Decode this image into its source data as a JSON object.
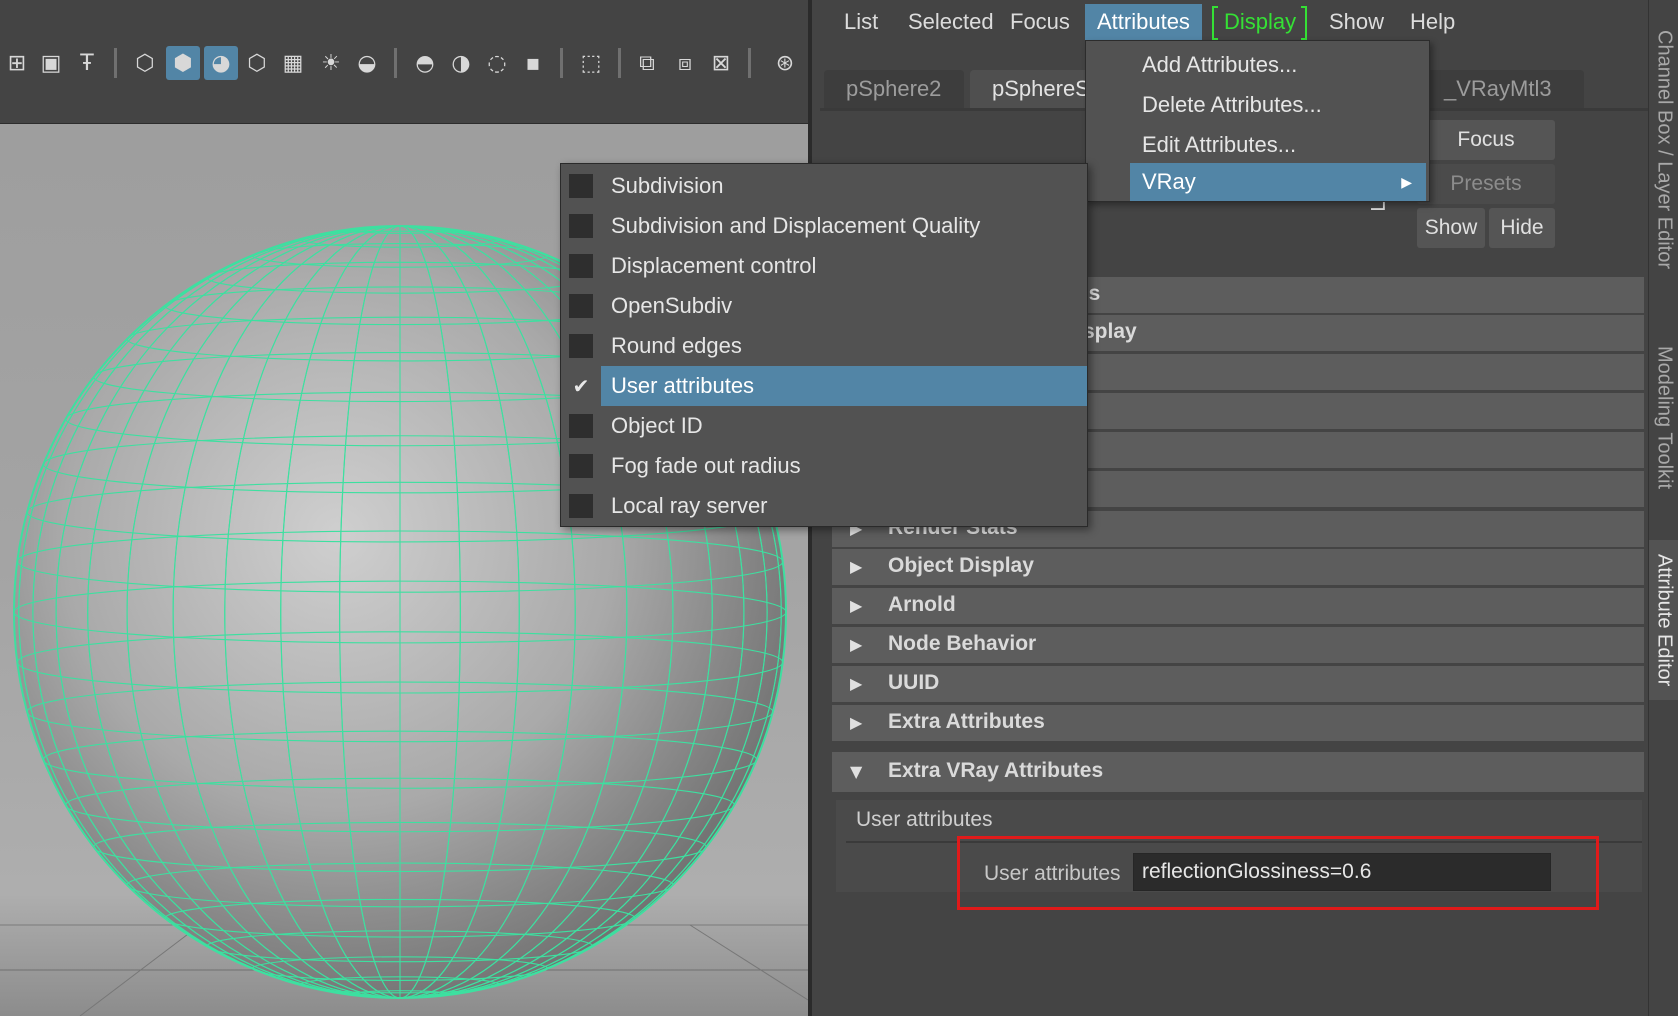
{
  "menubar": {
    "list": "List",
    "selected": "Selected",
    "focus": "Focus",
    "attributes": "Attributes",
    "display": "Display",
    "show": "Show",
    "help": "Help"
  },
  "tabs": {
    "psphere2": "pSphere2",
    "psphere_shape": "pSphereS",
    "vraymtl": "_VRayMtl3"
  },
  "buttons": {
    "focus": "Focus",
    "presets": "Presets",
    "show": "Show",
    "hide": "Hide"
  },
  "sections": {
    "partial1": "tes",
    "partial2": "Display",
    "render_stats": "Render Stats",
    "object_display": "Object Display",
    "arnold": "Arnold",
    "node_behavior": "Node Behavior",
    "uuid": "UUID",
    "extra_attributes": "Extra Attributes",
    "extra_vray": "Extra VRay Attributes"
  },
  "user_attributes_panel": {
    "frame_label": "User attributes",
    "field_label": "User attributes",
    "field_value": "reflectionGlossiness=0.6"
  },
  "attributes_menu": {
    "add": "Add Attributes...",
    "delete": "Delete Attributes...",
    "edit": "Edit Attributes...",
    "vray": "VRay"
  },
  "vray_submenu": [
    {
      "label": "Subdivision",
      "checked": false
    },
    {
      "label": "Subdivision and Displacement Quality",
      "checked": false
    },
    {
      "label": "Displacement control",
      "checked": false
    },
    {
      "label": "OpenSubdiv",
      "checked": false
    },
    {
      "label": "Round edges",
      "checked": false
    },
    {
      "label": "User attributes",
      "checked": true
    },
    {
      "label": "Object ID",
      "checked": false
    },
    {
      "label": "Fog fade out radius",
      "checked": false
    },
    {
      "label": "Local ray server",
      "checked": false
    }
  ],
  "side_tabs": {
    "channel_box": "Channel Box / Layer Editor",
    "modeling_toolkit": "Modeling Toolkit",
    "attribute_editor": "Attribute Editor"
  },
  "colors": {
    "selection": "#5285a6",
    "wireframe": "#3de0a0",
    "highlight_display": "#35e035",
    "callout": "#e01a1a"
  }
}
